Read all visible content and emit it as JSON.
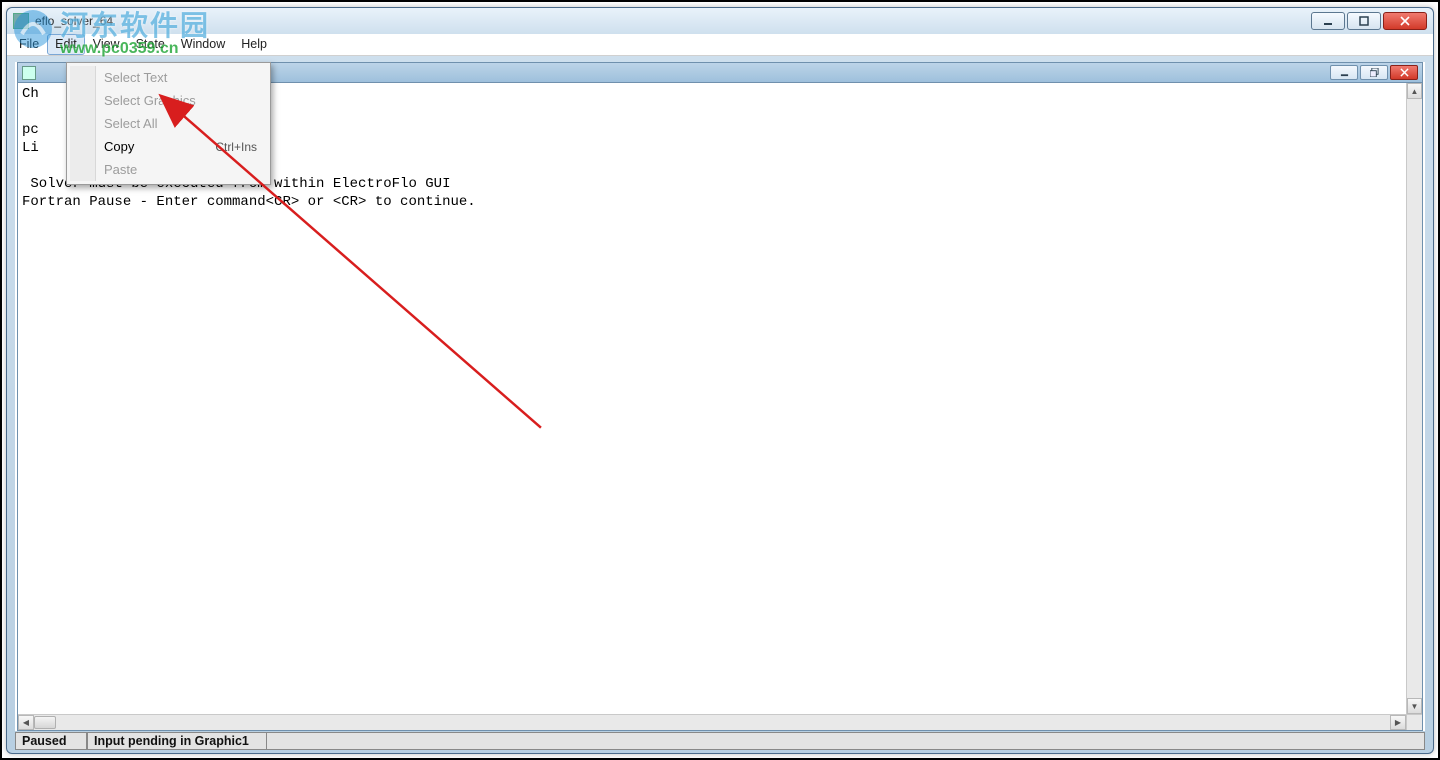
{
  "outer_window": {
    "title": "eflo_solver_64"
  },
  "menubar": {
    "items": [
      "File",
      "Edit",
      "View",
      "State",
      "Window",
      "Help"
    ],
    "active_index": 1
  },
  "dropdown": {
    "items": [
      {
        "label": "Select Text",
        "shortcut": "",
        "enabled": false
      },
      {
        "label": "Select Graphics",
        "shortcut": "",
        "enabled": false
      },
      {
        "label": "Select All",
        "shortcut": "",
        "enabled": false
      },
      {
        "label": "Copy",
        "shortcut": "Ctrl+Ins",
        "enabled": true
      },
      {
        "label": "Paste",
        "shortcut": "",
        "enabled": false
      }
    ]
  },
  "document": {
    "lines": [
      "Ch",
      "",
      "pc",
      "Li",
      "",
      " Solver must be executed from within ElectroFlo GUI",
      "Fortran Pause - Enter command<CR> or <CR> to continue."
    ]
  },
  "statusbar": {
    "left": "Paused",
    "right": "Input pending in Graphic1"
  },
  "watermark": {
    "cn": "河东软件园",
    "url": "www.pc0359.cn"
  }
}
